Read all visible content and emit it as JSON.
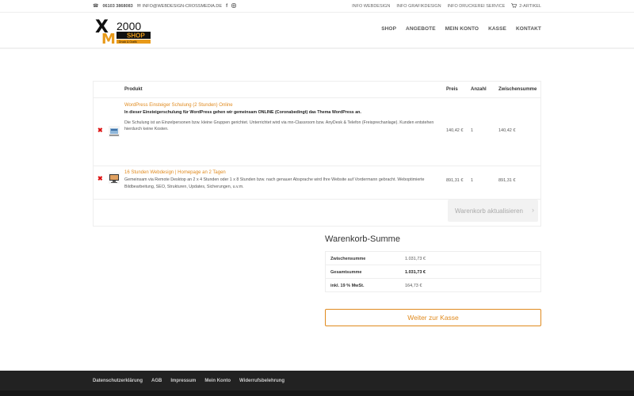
{
  "topbar": {
    "phone": "06103 3868083",
    "email": "INFO@WEBDESIGN-CROSSMEDIA.DE",
    "links": [
      "INFO WEBDESIGN",
      "INFO GRAFIKDESIGN",
      "INFO DRUCKEREI SERVICE"
    ],
    "cart_label": "2-ARTIKEL"
  },
  "header": {
    "logo": {
      "letters": "XM",
      "number": "2000",
      "word": "SHOP",
      "tagline": "Druck & Grafik"
    },
    "nav": [
      "SHOP",
      "ANGEBOTE",
      "MEIN KONTO",
      "KASSE",
      "KONTAKT"
    ]
  },
  "cart": {
    "headers": {
      "product": "Produkt",
      "price": "Preis",
      "qty": "Anzahl",
      "subtotal": "Zwischensumme"
    },
    "items": [
      {
        "name": "WordPress Einsteiger Schulung (2 Stunden) Online",
        "desc_bold": "In dieser Einsteigerschulung für WordPress gehen wir gemeinsam ONLINE (Coronabedingt) das Thema WordPress an.",
        "desc": "Die Schulung ist an Einzelpersonen bzw. kleine Gruppen gerichtet. Unterrichtet wird via mn-Classroom bzw. AnyDesk & Telefon (Freisprechanlage). Kunden entstehen hierdurch keine Kosten.",
        "price": "140,42 €",
        "qty": "1",
        "subtotal": "140,42 €"
      },
      {
        "name": "16 Stunden Webdesign | Homepage an 2 Tagen",
        "desc": "Gemeinsam via Remote Desktop an 2 x 4 Stunden oder 1 x 8 Stunden bzw. nach genauer Absprache wird Ihre Website auf Vordermann gebracht. Weboptimierte Bildbearbeitung, SEO, Strukturen, Updates, Sicherungen, u.v.m.",
        "price": "891,31 €",
        "qty": "1",
        "subtotal": "891,31 €"
      }
    ],
    "update_button": "Warenkorb aktualisieren"
  },
  "totals": {
    "title": "Warenkorb-Summe",
    "rows": [
      {
        "label": "Zwischensumme",
        "value": "1.031,73 €"
      },
      {
        "label": "Gesamtsumme",
        "value": "1.031,73 €"
      },
      {
        "label": "inkl. 19 % MwSt.",
        "value": "164,73 €"
      }
    ],
    "checkout_button": "Weiter zur Kasse"
  },
  "footer": {
    "links": [
      "Datenschutzerklärung",
      "AGB",
      "Impressum",
      "Mein Konto",
      "Widerrufsbelehrung"
    ]
  },
  "colors": {
    "accent": "#e08a1e",
    "remove": "#dd1111",
    "footer_bg": "#222222"
  }
}
